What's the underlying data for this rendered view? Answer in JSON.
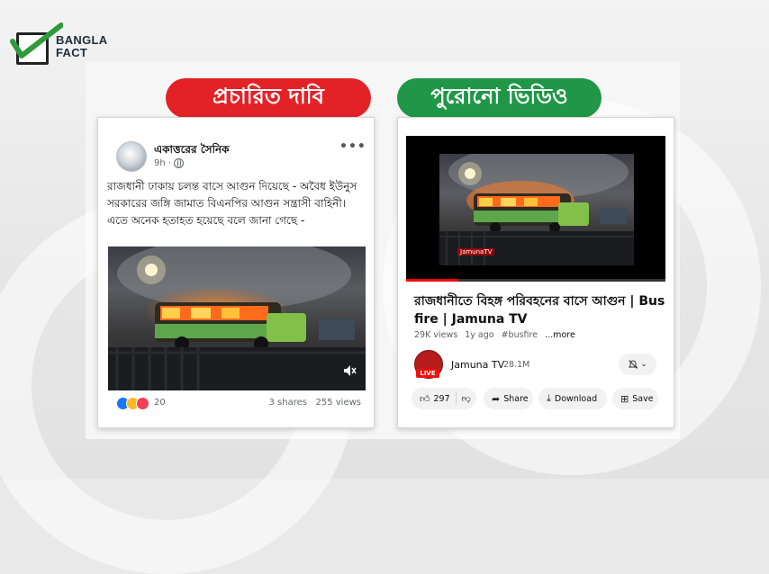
{
  "brand": {
    "line1": "BANGLA",
    "line2": "FACT"
  },
  "labels": {
    "claim": "প্রচারিত দাবি",
    "original": "পুরোনো ভিডিও"
  },
  "facebook_post": {
    "page_name": "একাত্তরের সৈনিক",
    "time": "9h ·",
    "text": "রাজধানী ঢাকায়  চলন্ত বাসে আগুন দিয়েছে - অবৈধ ইউনুস সরকারের জঙ্গি জামাত বিএনপির আগুন সন্ত্রাসী বাহিনী। এতে অনেক হতাহত হয়েছে বলে জানা গেছে  -",
    "reaction_count": "20",
    "stats": "3 shares   255 views",
    "icons": [
      "globe-icon",
      "more-icon",
      "volume-icon"
    ]
  },
  "youtube_video": {
    "watermark": "JamunaTV",
    "progress": 0.2,
    "title": "রাজধানীতে বিহঙ্গ পরিবহনের বাসে আগুন | Bus fire | Jamuna TV",
    "views": "29K views",
    "age": "1y ago",
    "hashtag": "#busfire",
    "more": "...more",
    "channel": "Jamuna TV",
    "subscribers": "28.1M",
    "live": "LIVE",
    "like_count": "297",
    "share_label": "Share",
    "download_label": "Download",
    "save_label": "Save",
    "colors": {
      "progress": "#ff0000",
      "red_pill": "#e32228",
      "green_pill": "#1f9746"
    }
  }
}
